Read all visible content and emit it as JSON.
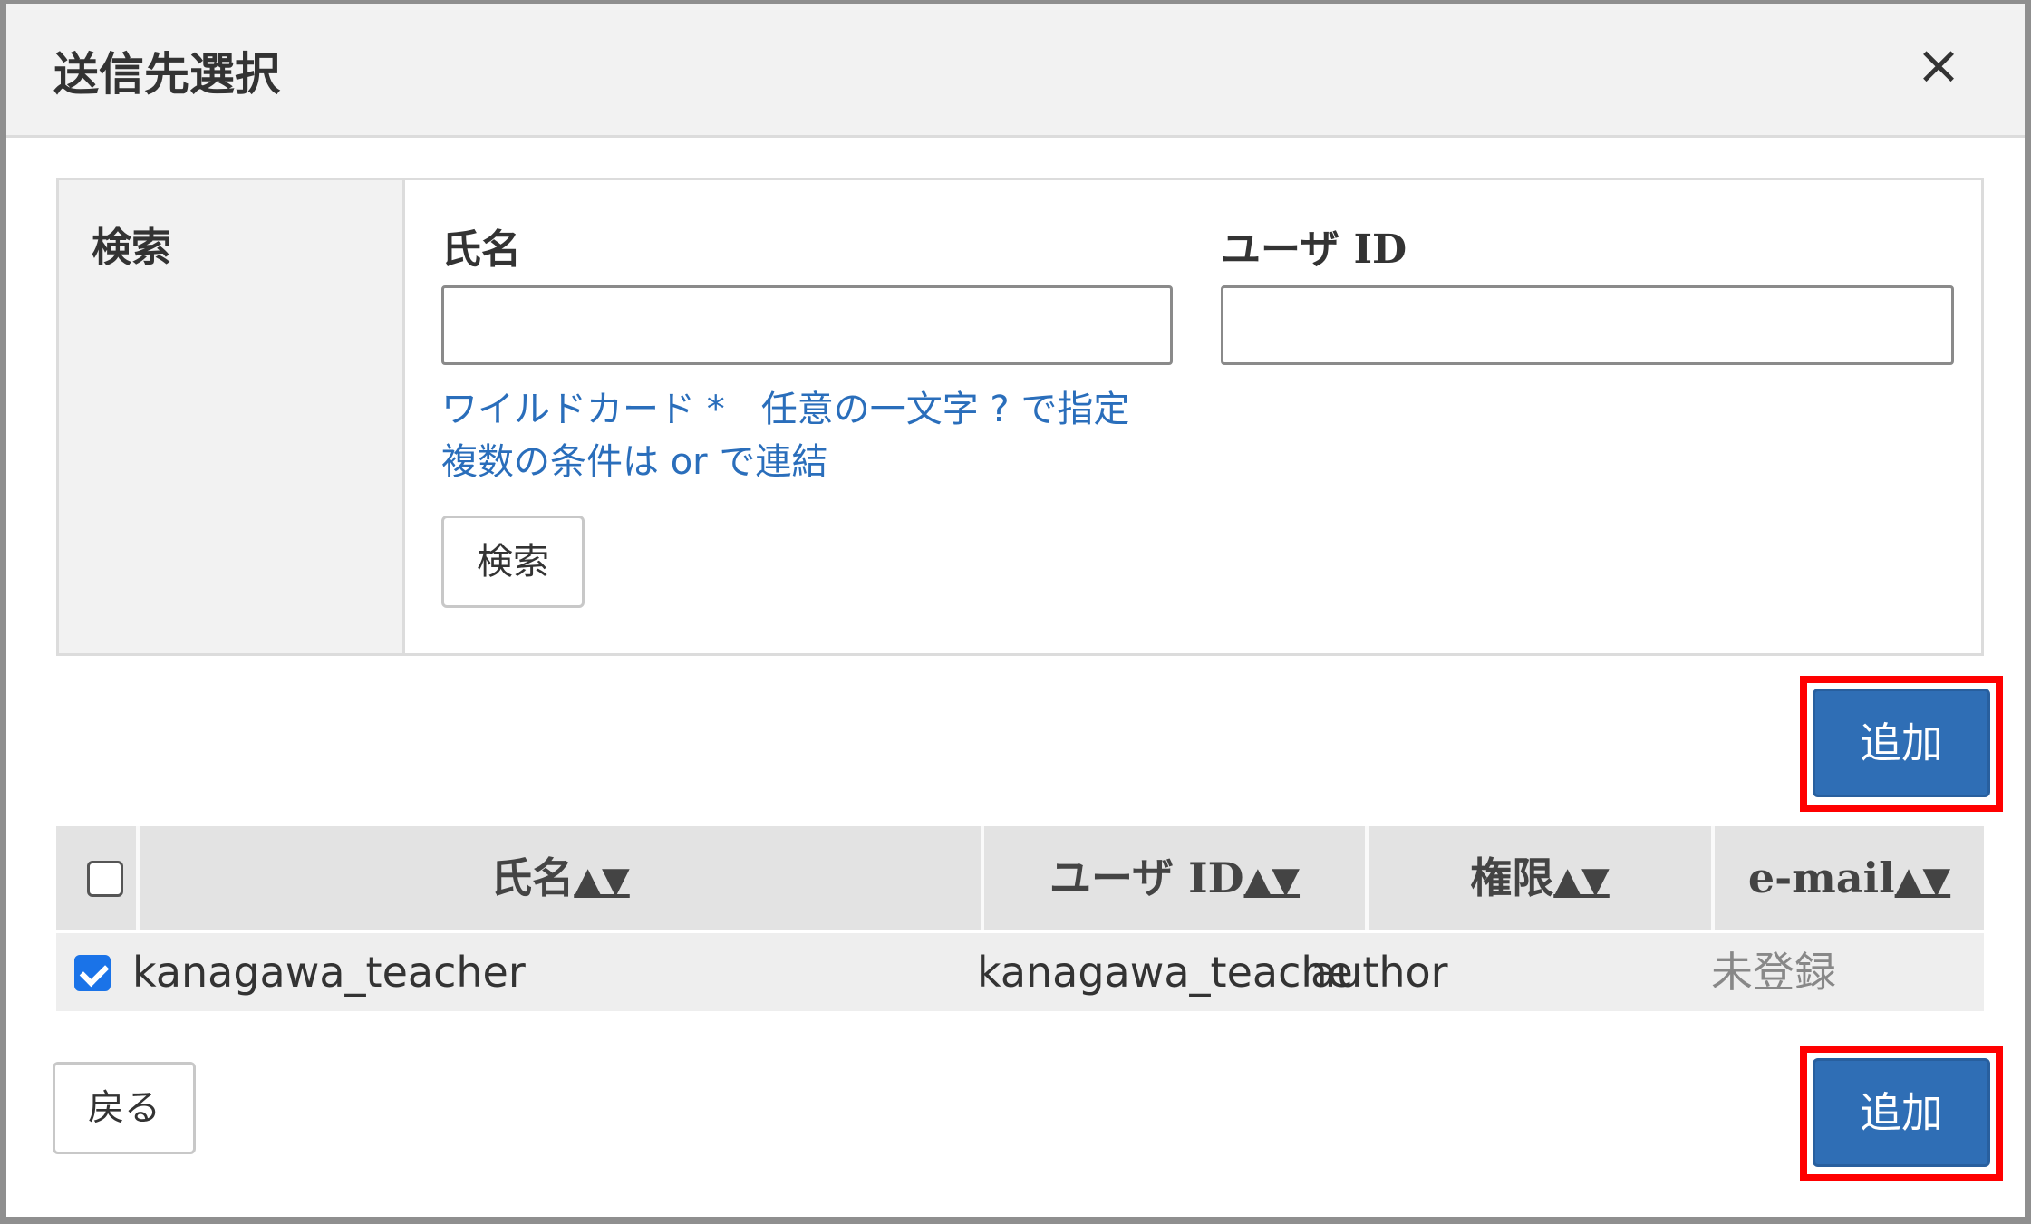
{
  "dialog": {
    "title": "送信先選択",
    "close_label": "×"
  },
  "search": {
    "side_label": "検索",
    "name_label": "氏名",
    "name_value": "",
    "userid_label": "ユーザ ID",
    "userid_value": "",
    "hint_line1": "ワイルドカード *　任意の一文字 ? で指定",
    "hint_line2": "複数の条件は or で連結",
    "search_button": "検索"
  },
  "actions": {
    "add_top": "追加",
    "add_bottom": "追加",
    "back": "戻る"
  },
  "table": {
    "headers": [
      {
        "label": "氏名",
        "sort": "▲▼"
      },
      {
        "label": "ユーザ ID",
        "sort": "▲▼"
      },
      {
        "label": "権限",
        "sort": "▲▼"
      },
      {
        "label": "e-mail",
        "sort": "▲▼"
      }
    ],
    "rows": [
      {
        "checked": true,
        "name": "kanagawa_teacher",
        "userid": "kanagawa_teache",
        "role": "author",
        "email": "未登録"
      }
    ]
  },
  "colors": {
    "primary": "#2f6eb5",
    "highlight": "#ff0000",
    "link": "#2a6ebb"
  }
}
